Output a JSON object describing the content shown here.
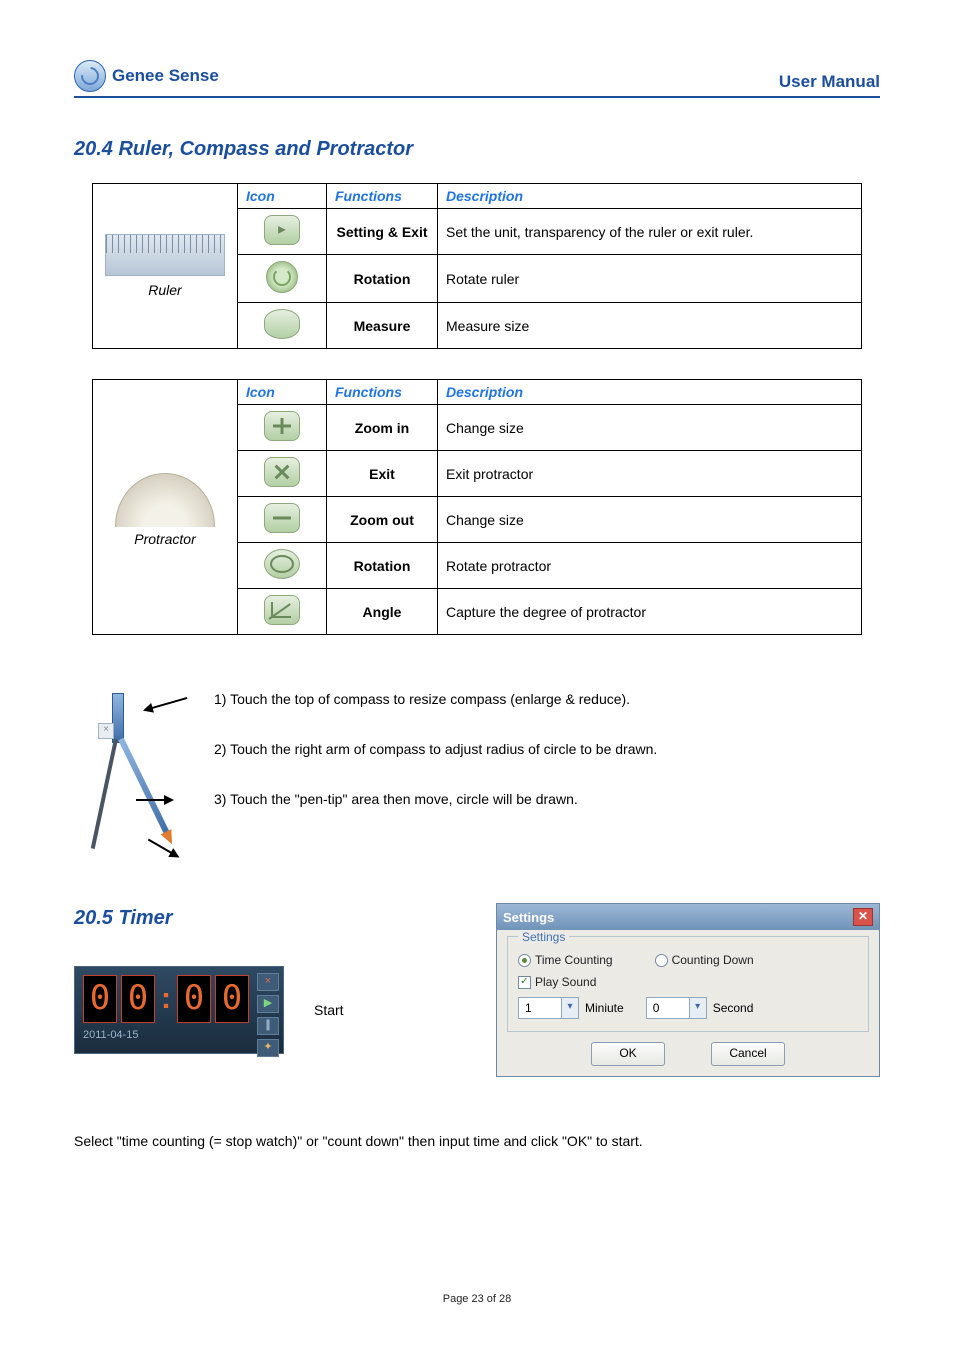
{
  "header": {
    "product": "Genee Sense",
    "doc": "User Manual"
  },
  "section204": {
    "title": "20.4  Ruler, Compass and Protractor",
    "columns": {
      "icon": "Icon",
      "functions": "Functions",
      "description": "Description"
    },
    "ruler": {
      "label": "Ruler",
      "rows": [
        {
          "func": "Setting & Exit",
          "desc": "Set the unit, transparency of the ruler or exit ruler."
        },
        {
          "func": "Rotation",
          "desc": "Rotate ruler"
        },
        {
          "func": "Measure",
          "desc": "Measure size"
        }
      ]
    },
    "protractor": {
      "label": "Protractor",
      "rows": [
        {
          "func": "Zoom in",
          "desc": "Change size"
        },
        {
          "func": "Exit",
          "desc": "Exit protractor"
        },
        {
          "func": "Zoom out",
          "desc": "Change size"
        },
        {
          "func": "Rotation",
          "desc": "Rotate protractor"
        },
        {
          "func": "Angle",
          "desc": "Capture the degree of protractor"
        }
      ]
    },
    "compass_steps": [
      "1)   Touch the top of compass to resize compass (enlarge & reduce).",
      "2)   Touch the right arm of compass to adjust radius of circle to be drawn.",
      "3)   Touch the \"pen-tip\" area then move, circle will be drawn."
    ]
  },
  "section205": {
    "title": "20.5 Timer",
    "start_label": "Start",
    "widget": {
      "time": "00:00",
      "digits": [
        "0",
        "0",
        "0",
        "0"
      ],
      "date": "2011-04-15"
    },
    "settings": {
      "title": "Settings",
      "group_label": "Settings",
      "time_counting": "Time Counting",
      "counting_down": "Counting Down",
      "time_counting_selected": true,
      "play_sound": "Play Sound",
      "play_sound_checked": true,
      "minute_label": "Miniute",
      "second_label": "Second",
      "minute_value": "1",
      "second_value": "0",
      "ok": "OK",
      "cancel": "Cancel"
    },
    "body_text": "Select \"time counting (= stop watch)\" or \"count down\" then input time and click \"OK\" to start."
  },
  "footer": "Page 23 of 28"
}
